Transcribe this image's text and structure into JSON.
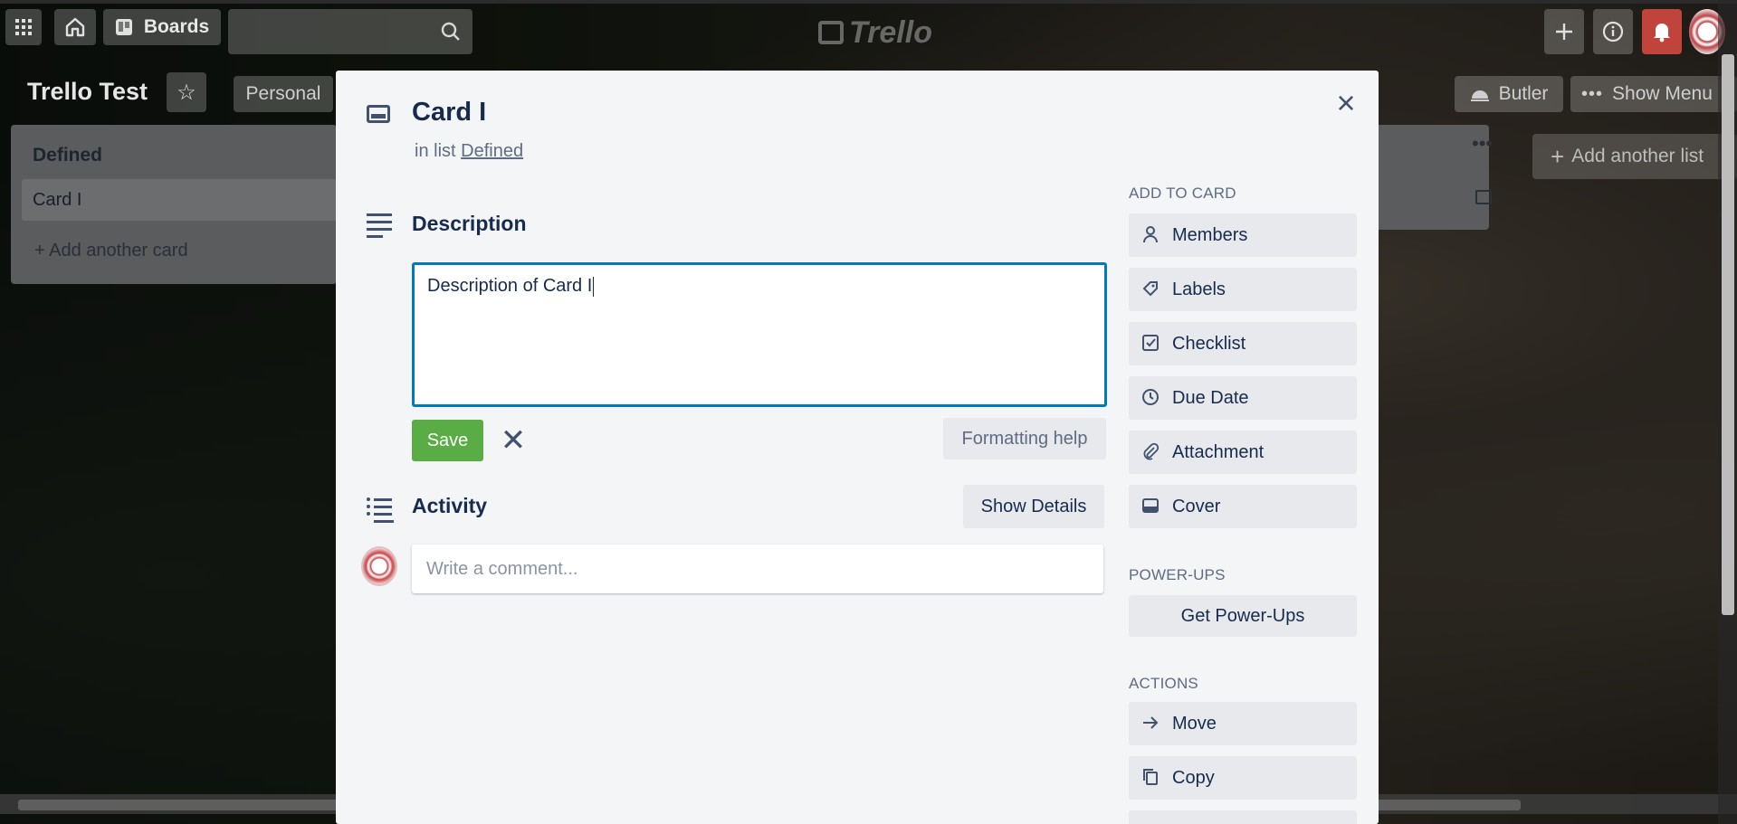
{
  "header": {
    "boards_label": "Boards",
    "logo_text": "Trello"
  },
  "board": {
    "title": "Trello Test",
    "visibility": "Personal",
    "butler_label": "Butler",
    "show_menu_label": "Show Menu",
    "add_list_label": "Add another list"
  },
  "list": {
    "title": "Defined",
    "cards": [
      "Card I"
    ],
    "add_card_label": "Add another card"
  },
  "modal": {
    "card_title": "Card I",
    "in_list_prefix": "in list",
    "list_name": "Defined",
    "description_heading": "Description",
    "description_text": "Description of Card I",
    "save_label": "Save",
    "formatting_help_label": "Formatting help",
    "activity_heading": "Activity",
    "show_details_label": "Show Details",
    "comment_placeholder": "Write a comment...",
    "add_to_card_heading": "ADD TO CARD",
    "add_to_card": [
      "Members",
      "Labels",
      "Checklist",
      "Due Date",
      "Attachment",
      "Cover"
    ],
    "power_ups_heading": "POWER-UPS",
    "get_power_ups_label": "Get Power-Ups",
    "actions_heading": "ACTIONS",
    "actions": [
      "Move",
      "Copy"
    ]
  },
  "colors": {
    "save_green": "#5aac44",
    "focus_blue": "#0079bf",
    "notification_red": "#c0443b"
  }
}
